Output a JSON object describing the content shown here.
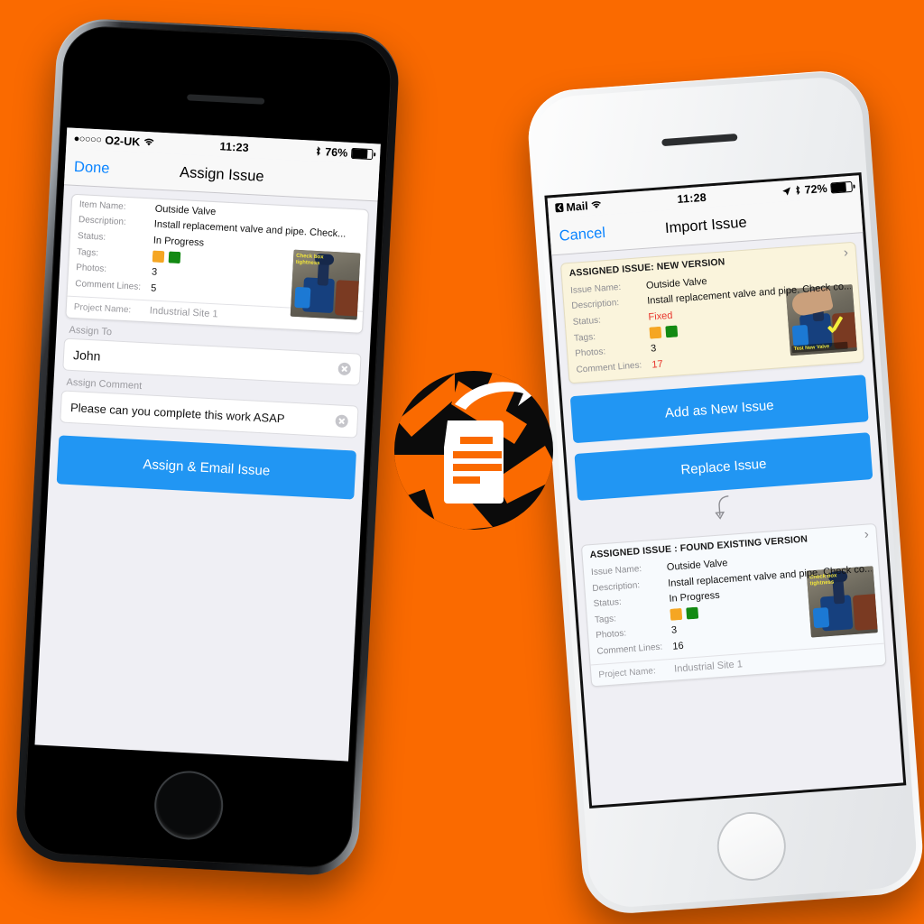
{
  "background_color": "#FA6A00",
  "accent_blue": "#2196F3",
  "tag_colors": {
    "orange": "#F5A623",
    "green": "#138A13"
  },
  "left_phone": {
    "frame": "black",
    "status_bar": {
      "carrier": "O2-UK",
      "signal_dots": "●○○○○",
      "wifi_icon": "wifi-icon",
      "time": "11:23",
      "bluetooth_icon": "bluetooth-icon",
      "battery_percent": "76%",
      "battery_level": 76
    },
    "navbar": {
      "left_action": "Done",
      "title": "Assign Issue"
    },
    "detail_card": {
      "rows": [
        {
          "label": "Item Name:",
          "value": "Outside Valve"
        },
        {
          "label": "Description:",
          "value": "Install replacement valve and pipe. Check..."
        },
        {
          "label": "Status:",
          "value": "In Progress"
        },
        {
          "label": "Tags:",
          "value": ""
        },
        {
          "label": "Photos:",
          "value": "3"
        },
        {
          "label": "Comment Lines:",
          "value": "5"
        }
      ],
      "footer": {
        "label": "Project Name:",
        "value": "Industrial Site 1"
      },
      "thumbnail": {
        "name": "valve-photo-thumbnail",
        "caption": "Check box tightness"
      }
    },
    "form": {
      "assign_to_label": "Assign To",
      "assign_to_value": "John",
      "assign_to_placeholder": "Assign To",
      "assign_comment_label": "Assign Comment",
      "assign_comment_value": "Please can you complete this work ASAP",
      "assign_comment_placeholder": "Assign Comment",
      "submit_label": "Assign & Email Issue"
    }
  },
  "right_phone": {
    "frame": "white",
    "status_bar": {
      "back_app": "Mail",
      "wifi_icon": "wifi-icon",
      "time": "11:28",
      "location_icon": "location-arrow-icon",
      "bluetooth_icon": "bluetooth-icon",
      "battery_percent": "72%",
      "battery_level": 72
    },
    "navbar": {
      "left_action": "Cancel",
      "title": "Import Issue"
    },
    "new_version_card": {
      "heading": "ASSIGNED ISSUE: NEW VERSION",
      "disclosure_icon": "chevron-right-icon",
      "rows": [
        {
          "label": "Issue Name:",
          "value": "Outside Valve",
          "highlight": false
        },
        {
          "label": "Description:",
          "value": "Install replacement valve and pipe. Check co...",
          "highlight": false
        },
        {
          "label": "Status:",
          "value": "Fixed",
          "highlight": true
        },
        {
          "label": "Tags:",
          "value": "",
          "highlight": false
        },
        {
          "label": "Photos:",
          "value": "3",
          "highlight": false
        },
        {
          "label": "Comment Lines:",
          "value": "17",
          "highlight": true
        }
      ],
      "thumbnail": {
        "name": "new-valve-photo-thumbnail",
        "caption": "Test New Valve"
      }
    },
    "buttons": {
      "add_as_new": "Add as New Issue",
      "replace": "Replace Issue"
    },
    "flow_arrow_icon": "curved-down-arrow-icon",
    "existing_version_card": {
      "heading": "ASSIGNED ISSUE : FOUND EXISTING VERSION",
      "disclosure_icon": "chevron-right-icon",
      "rows": [
        {
          "label": "Issue Name:",
          "value": "Outside Valve",
          "highlight": false
        },
        {
          "label": "Description:",
          "value": "Install replacement valve and pipe. Check co...",
          "highlight": false
        },
        {
          "label": "Status:",
          "value": "In Progress",
          "highlight": false
        },
        {
          "label": "Tags:",
          "value": "",
          "highlight": false
        },
        {
          "label": "Photos:",
          "value": "3",
          "highlight": false
        },
        {
          "label": "Comment Lines:",
          "value": "16",
          "highlight": false
        }
      ],
      "footer": {
        "label": "Project Name:",
        "value": "Industrial Site 1"
      },
      "thumbnail": {
        "name": "existing-valve-photo-thumbnail",
        "caption": "Check box tightness"
      }
    }
  },
  "center_logo": {
    "name": "document-import-aperture-logo"
  }
}
